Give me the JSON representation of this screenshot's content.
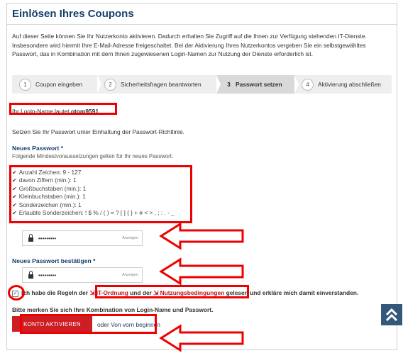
{
  "page": {
    "title": "Einlösen Ihres Coupons",
    "intro": "Auf dieser Seite können Sie Ihr Nutzerkonto aktivieren. Dadurch erhalten Sie Zugriff auf die Ihnen zur Verfügung stehenden IT-Dienste. Insbesondere wird hiermit Ihre E-Mail-Adresse freigeschaltet. Bei der Aktivierung Ihres Nutzerkontos vergeben Sie ein selbstgewähltes Passwort, das in Kombination mit dem Ihnen zugewiesenen Login-Namen zur Nutzung der Dienste erforderlich ist."
  },
  "steps": [
    {
      "num": "1",
      "label": "Coupon eingeben",
      "active": false
    },
    {
      "num": "2",
      "label": "Sicherheitsfragen beantworten",
      "active": false
    },
    {
      "num": "3",
      "label": "Passwort setzen",
      "active": true
    },
    {
      "num": "4",
      "label": "Aktivierung abschließen",
      "active": false
    }
  ],
  "login": {
    "prefix": "Ihr Login-Name lautet ",
    "name": "otom9591",
    "suffix": "."
  },
  "policy_note": "Setzen Sie Ihr Passwort unter Einhaltung der Passwort-Richtlinie.",
  "new_password": {
    "label": "Neues Passwort *",
    "requirements_intro": "Folgende Mindestvoraussetzungen gelten für Ihr neues Passwort:",
    "requirements": [
      "Anzahl Zeichen: 9 - 127",
      "davon Ziffern (min.): 1",
      "Großbuchstaben (min.): 1",
      "Kleinbuchstaben (min.): 1",
      "Sonderzeichen (min.): 1",
      "Erlaubte Sonderzeichen: ! $ % / ( ) = ? [ ] { } + # < > , ; : . - _"
    ],
    "value": "•••••••••",
    "show_label": "Anzeigen"
  },
  "confirm_password": {
    "label": "Neues Passwort bestätigen *",
    "value": "•••••••••",
    "show_label": "Anzeigen"
  },
  "agreement": {
    "checked": "✓",
    "text_before": "Ich habe die Regeln der ",
    "link1": "IT-Ordnung",
    "text_mid": " und der ",
    "link2": "Nutzungsbedingungen",
    "text_after": " gelesen und erkläre mich damit einverstanden."
  },
  "reminder": "Bitte merken Sie sich Ihre Kombination von Login-Name und Passwort.",
  "actions": {
    "activate": "KONTO AKTIVIEREN",
    "or": "oder ",
    "restart": "Von vorn beginnen"
  },
  "icons": {
    "check": "check-icon",
    "lock": "lock-icon",
    "external_link": "external-link-icon",
    "scroll_top": "double-chevron-up-icon"
  },
  "colors": {
    "heading": "#153f6a",
    "accent": "#cf1d24",
    "annotation": "#ee0000",
    "scroll_top_bg": "#34577c"
  }
}
